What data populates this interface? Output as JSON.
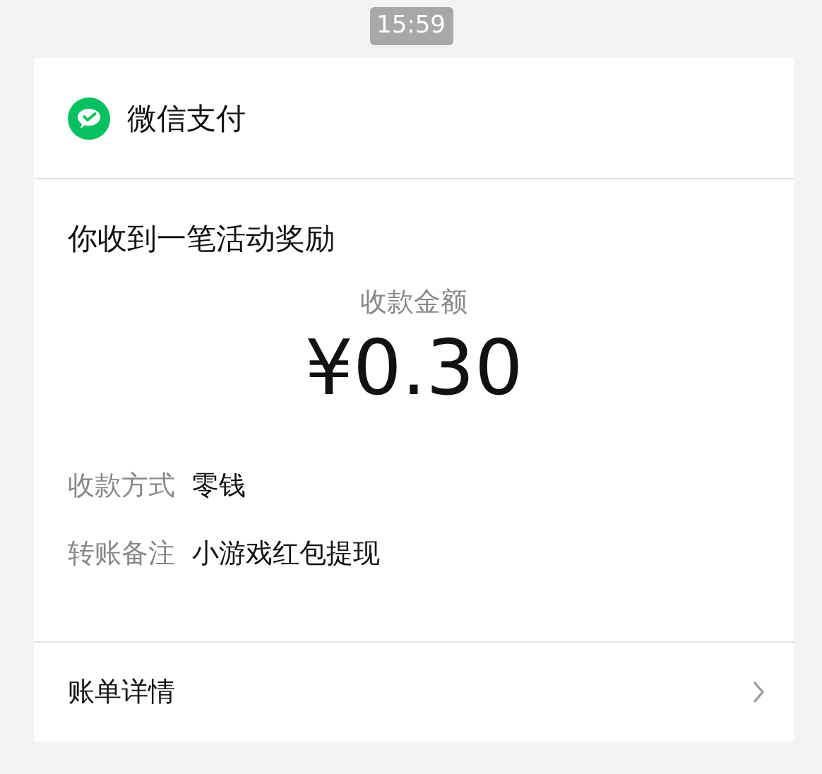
{
  "timestamp": "15:59",
  "card": {
    "app_name": "微信支付",
    "title": "你收到一笔活动奖励",
    "amount_label": "收款金额",
    "amount": "¥0.30",
    "details": [
      {
        "label": "收款方式",
        "value": "零钱"
      },
      {
        "label": "转账备注",
        "value": "小游戏红包提现"
      }
    ],
    "footer_link": "账单详情"
  }
}
